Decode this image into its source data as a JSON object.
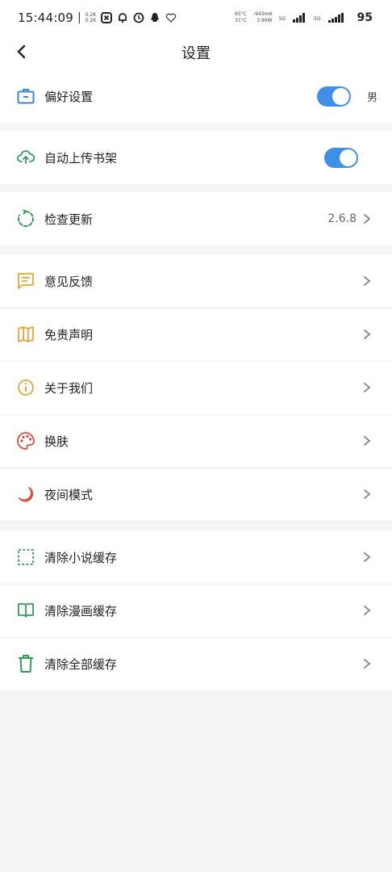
{
  "status_bar": {
    "time": "15:44:09",
    "speed_up": "0.2K",
    "speed_down": "0.2K",
    "temp_cpu": "65°C",
    "temp_battery": "31°C",
    "current": "-943mA",
    "power": "3.99W",
    "net1": "5G",
    "net2": "5G",
    "battery": "95"
  },
  "header": {
    "title": "设置"
  },
  "groups": {
    "g1": {
      "preference": {
        "label": "偏好设置",
        "toggle_on": true,
        "gender": "男"
      }
    },
    "g2": {
      "auto_upload": {
        "label": "自动上传书架",
        "toggle_on": true
      }
    },
    "g3": {
      "check_update": {
        "label": "检查更新",
        "version": "2.6.8"
      }
    },
    "g4": {
      "feedback": {
        "label": "意见反馈"
      },
      "disclaimer": {
        "label": "免责声明"
      },
      "about": {
        "label": "关于我们"
      },
      "skin": {
        "label": "换肤"
      },
      "night_mode": {
        "label": "夜间模式"
      }
    },
    "g5": {
      "clear_novel": {
        "label": "清除小说缓存"
      },
      "clear_comic": {
        "label": "清除漫画缓存"
      },
      "clear_all": {
        "label": "清除全部缓存"
      }
    }
  },
  "colors": {
    "blue_icon": "#3d86c8",
    "green_icon": "#2e9e57",
    "orange_icon": "#e8a53a",
    "red_icon": "#d9503f",
    "toggle_on": "#3f8fe8",
    "background": "#f4f5f7"
  }
}
